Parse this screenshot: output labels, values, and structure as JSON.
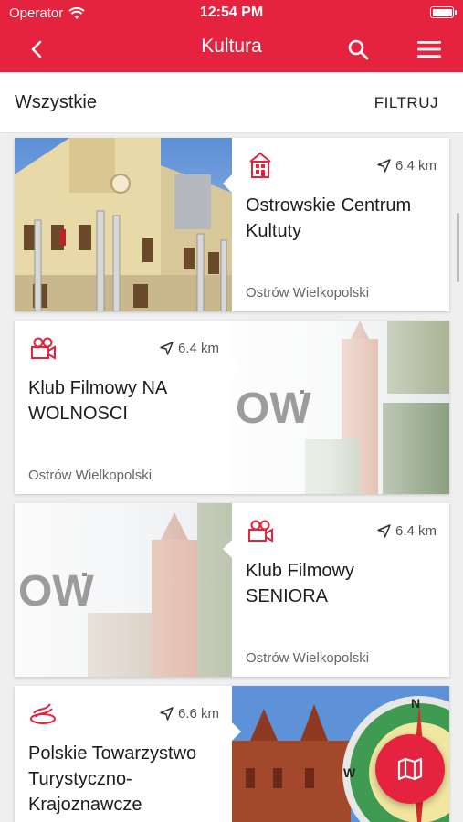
{
  "status": {
    "carrier": "Operator",
    "time": "12:54 PM"
  },
  "nav": {
    "title": "Kultura"
  },
  "filterbar": {
    "all_label": "Wszystkie",
    "filter_label": "FILTRUJ"
  },
  "cards": [
    {
      "category_icon": "culture-house-icon",
      "distance": "6.4 km",
      "name": "Ostrowskie Centrum Kultuty",
      "city": "Ostrów Wielkopolski"
    },
    {
      "category_icon": "film-camera-icon",
      "distance": "6.4 km",
      "name": "Klub Filmowy NA WOLNOSCI",
      "city": "Ostrów Wielkopolski"
    },
    {
      "category_icon": "film-camera-icon",
      "distance": "6.4 km",
      "name": "Klub Filmowy SENIORA",
      "city": "Ostrów Wielkopolski"
    },
    {
      "category_icon": "hiking-trail-icon",
      "distance": "6.6 km",
      "name": "Polskie Towarzystwo Turystyczno-Krajoznawcze",
      "city": ""
    }
  ],
  "colors": {
    "brand": "#e6233f"
  }
}
